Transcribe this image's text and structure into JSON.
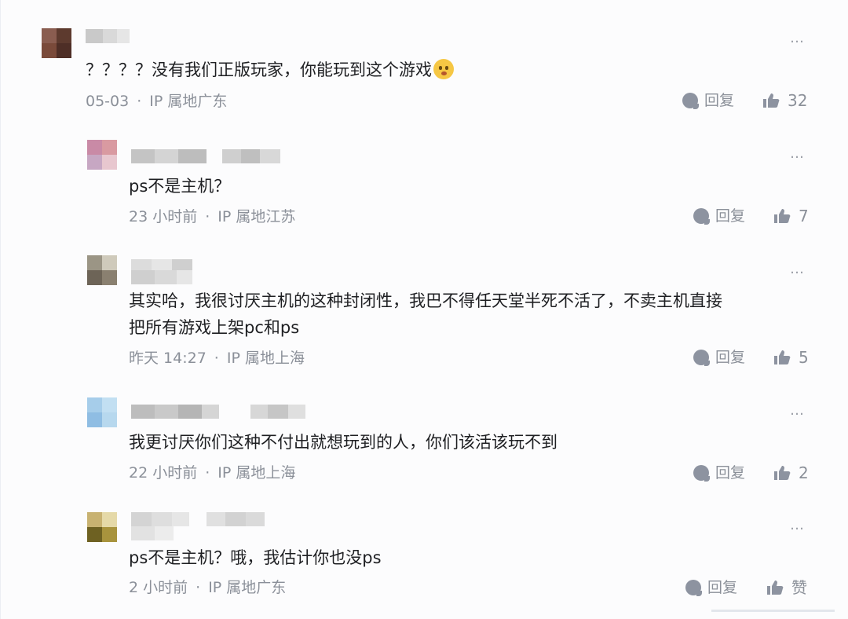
{
  "comments": [
    {
      "text": "？？？？没有我们正版玩家，你能玩到这个游戏",
      "emoji": "flushed-face",
      "time": "05-03",
      "ip": "IP 属地广东",
      "reply_label": "回复",
      "likes": "32"
    },
    {
      "text": "ps不是主机？",
      "time": "23 小时前",
      "ip": "IP 属地江苏",
      "reply_label": "回复",
      "likes": "7"
    },
    {
      "text_line1": "其实哈，我很讨厌主机的这种封闭性，我巴不得任天堂半死不活了，不卖主机直接",
      "text_line2": "把所有游戏上架pc和ps",
      "time": "昨天 14:27",
      "ip": "IP 属地上海",
      "reply_label": "回复",
      "likes": "5"
    },
    {
      "text": "我更讨厌你们这种不付出就想玩到的人，你们该活该玩不到",
      "time": "22 小时前",
      "ip": "IP 属地上海",
      "reply_label": "回复",
      "likes": "2"
    },
    {
      "text": "ps不是主机？哦，我估计你也没ps",
      "time": "2 小时前",
      "ip": "IP 属地广东",
      "reply_label": "回复",
      "likes": "赞"
    }
  ],
  "separator": "·",
  "more_icon": "…",
  "icons": {
    "reply": "comment-bubble-icon",
    "like": "thumbs-up-icon",
    "more": "more-dots-icon"
  },
  "colors": {
    "text": "#1e1f22",
    "meta": "#8b9099",
    "icon": "#8d93a0"
  }
}
